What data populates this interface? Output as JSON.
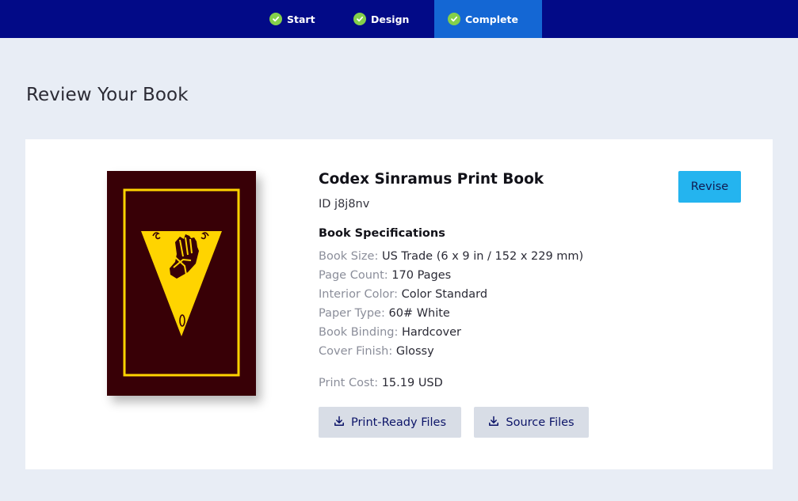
{
  "stepper": {
    "steps": [
      {
        "label": "Start",
        "status": "complete"
      },
      {
        "label": "Design",
        "status": "complete"
      },
      {
        "label": "Complete",
        "status": "complete",
        "active": true
      }
    ]
  },
  "page_title": "Review Your Book",
  "book": {
    "title": "Codex Sinramus Print Book",
    "id_text": "ID j8j8nv",
    "specs_heading": "Book Specifications",
    "specs": [
      {
        "label": "Book Size:",
        "value": "US Trade (6 x 9 in / 152 x 229 mm)"
      },
      {
        "label": "Page Count:",
        "value": "170 Pages"
      },
      {
        "label": "Interior Color:",
        "value": "Color Standard"
      },
      {
        "label": "Paper Type:",
        "value": "60# White"
      },
      {
        "label": "Book Binding:",
        "value": "Hardcover"
      },
      {
        "label": "Cover Finish:",
        "value": "Glossy"
      }
    ],
    "print_cost": {
      "label": "Print Cost:",
      "value": "15.19 USD"
    }
  },
  "actions": {
    "revise": "Revise",
    "print_ready_files": "Print-Ready Files",
    "source_files": "Source Files"
  },
  "icons": {
    "step_complete": "check-circle-icon",
    "download": "download-icon"
  },
  "colors": {
    "nav_bg": "#020a87",
    "nav_active": "#1467d4",
    "check": "#84d04a",
    "revise": "#24b4ef",
    "cover_bg": "#380006",
    "cover_gold": "#ffd400"
  }
}
